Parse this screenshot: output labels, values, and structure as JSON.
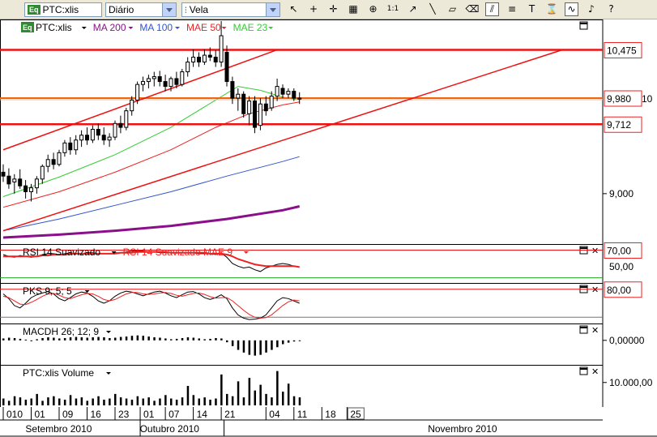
{
  "toolbar": {
    "symbol": "PTC:xlis",
    "symbol_badge": "Eq",
    "period": "Diário",
    "chart_type": "Vela",
    "tools": [
      {
        "name": "cursor-icon",
        "glyph": "↖"
      },
      {
        "name": "crosshair-icon",
        "glyph": "+"
      },
      {
        "name": "cross-arrow-icon",
        "glyph": "✛"
      },
      {
        "name": "grid-icon",
        "glyph": "▦"
      },
      {
        "name": "zoom-icon",
        "glyph": "⊕"
      },
      {
        "name": "zoom-1to1-icon",
        "glyph": "1:1"
      },
      {
        "name": "trend-arrow-icon",
        "glyph": "↗"
      },
      {
        "name": "trend-line-icon",
        "glyph": "╲"
      },
      {
        "name": "eraser-icon",
        "glyph": "▱"
      },
      {
        "name": "eraser-all-icon",
        "glyph": "⌫"
      },
      {
        "name": "channel-icon",
        "glyph": "⫽"
      },
      {
        "name": "fibonacci-icon",
        "glyph": "≡"
      },
      {
        "name": "text-tool-icon",
        "glyph": "T"
      },
      {
        "name": "alarm-icon",
        "glyph": "⌛"
      },
      {
        "name": "wave-icon",
        "glyph": "∿"
      },
      {
        "name": "bell-icon",
        "glyph": "♪"
      },
      {
        "name": "help-icon",
        "glyph": "?"
      }
    ]
  },
  "chart_data": [
    {
      "type": "candlestick",
      "panel": "price",
      "legend": [
        {
          "badge": "Eq",
          "label": "PTC:xlis",
          "color": "#000000"
        },
        {
          "label": "MA 200",
          "color": "#8b0f8b"
        },
        {
          "label": "MA 100",
          "color": "#3355cc"
        },
        {
          "label": "MAE 50",
          "color": "#ee2222"
        },
        {
          "label": "MAE 23",
          "color": "#33cc33"
        }
      ],
      "y_ticks": [
        "9,000"
      ],
      "y_tick_values": [
        9.0
      ],
      "ylim": [
        8.5,
        10.77
      ],
      "price_labels": [
        {
          "text": "10,475",
          "value": 10.475
        },
        {
          "text": "9,980",
          "value": 9.98
        },
        {
          "text": "9,712",
          "value": 9.712
        }
      ],
      "right_label_partial": "10",
      "horizontal_lines": [
        10.475,
        9.98,
        9.712
      ],
      "channel": [
        {
          "from": [
            0,
            9.45
          ],
          "to": [
            49,
            10.475
          ]
        },
        {
          "from": [
            0,
            8.62
          ],
          "to": [
            100,
            10.475
          ]
        }
      ],
      "candles": [
        {
          "o": 9.22,
          "h": 9.3,
          "l": 9.12,
          "c": 9.18
        },
        {
          "o": 9.18,
          "h": 9.26,
          "l": 9.05,
          "c": 9.1
        },
        {
          "o": 9.12,
          "h": 9.2,
          "l": 9.0,
          "c": 9.15
        },
        {
          "o": 9.15,
          "h": 9.25,
          "l": 9.05,
          "c": 9.08
        },
        {
          "o": 9.08,
          "h": 9.14,
          "l": 8.95,
          "c": 9.02
        },
        {
          "o": 9.02,
          "h": 9.1,
          "l": 8.92,
          "c": 9.06
        },
        {
          "o": 9.06,
          "h": 9.18,
          "l": 9.0,
          "c": 9.15
        },
        {
          "o": 9.15,
          "h": 9.3,
          "l": 9.1,
          "c": 9.28
        },
        {
          "o": 9.28,
          "h": 9.4,
          "l": 9.22,
          "c": 9.35
        },
        {
          "o": 9.35,
          "h": 9.42,
          "l": 9.25,
          "c": 9.3
        },
        {
          "o": 9.3,
          "h": 9.45,
          "l": 9.28,
          "c": 9.42
        },
        {
          "o": 9.42,
          "h": 9.55,
          "l": 9.38,
          "c": 9.52
        },
        {
          "o": 9.52,
          "h": 9.58,
          "l": 9.4,
          "c": 9.45
        },
        {
          "o": 9.45,
          "h": 9.6,
          "l": 9.4,
          "c": 9.55
        },
        {
          "o": 9.55,
          "h": 9.65,
          "l": 9.48,
          "c": 9.6
        },
        {
          "o": 9.6,
          "h": 9.68,
          "l": 9.5,
          "c": 9.55
        },
        {
          "o": 9.55,
          "h": 9.7,
          "l": 9.52,
          "c": 9.66
        },
        {
          "o": 9.66,
          "h": 9.72,
          "l": 9.55,
          "c": 9.6
        },
        {
          "o": 9.6,
          "h": 9.68,
          "l": 9.5,
          "c": 9.55
        },
        {
          "o": 9.55,
          "h": 9.62,
          "l": 9.48,
          "c": 9.58
        },
        {
          "o": 9.58,
          "h": 9.75,
          "l": 9.55,
          "c": 9.72
        },
        {
          "o": 9.72,
          "h": 9.8,
          "l": 9.62,
          "c": 9.68
        },
        {
          "o": 9.68,
          "h": 9.88,
          "l": 9.65,
          "c": 9.85
        },
        {
          "o": 9.85,
          "h": 10.0,
          "l": 9.8,
          "c": 9.96
        },
        {
          "o": 9.96,
          "h": 10.15,
          "l": 9.92,
          "c": 10.12
        },
        {
          "o": 10.12,
          "h": 10.2,
          "l": 10.05,
          "c": 10.15
        },
        {
          "o": 10.15,
          "h": 10.22,
          "l": 10.08,
          "c": 10.18
        },
        {
          "o": 10.18,
          "h": 10.25,
          "l": 10.1,
          "c": 10.2
        },
        {
          "o": 10.2,
          "h": 10.26,
          "l": 10.1,
          "c": 10.15
        },
        {
          "o": 10.15,
          "h": 10.22,
          "l": 10.05,
          "c": 10.1
        },
        {
          "o": 10.1,
          "h": 10.2,
          "l": 10.05,
          "c": 10.18
        },
        {
          "o": 10.18,
          "h": 10.25,
          "l": 10.08,
          "c": 10.12
        },
        {
          "o": 10.12,
          "h": 10.28,
          "l": 10.1,
          "c": 10.25
        },
        {
          "o": 10.25,
          "h": 10.4,
          "l": 10.2,
          "c": 10.35
        },
        {
          "o": 10.35,
          "h": 10.48,
          "l": 10.3,
          "c": 10.4
        },
        {
          "o": 10.4,
          "h": 10.45,
          "l": 10.3,
          "c": 10.35
        },
        {
          "o": 10.35,
          "h": 10.48,
          "l": 10.32,
          "c": 10.42
        },
        {
          "o": 10.42,
          "h": 10.5,
          "l": 10.36,
          "c": 10.4
        },
        {
          "o": 10.4,
          "h": 10.47,
          "l": 10.3,
          "c": 10.35
        },
        {
          "o": 10.35,
          "h": 10.77,
          "l": 10.3,
          "c": 10.62
        },
        {
          "o": 10.45,
          "h": 10.52,
          "l": 10.1,
          "c": 10.15
        },
        {
          "o": 10.15,
          "h": 10.2,
          "l": 9.92,
          "c": 9.98
        },
        {
          "o": 9.98,
          "h": 10.08,
          "l": 9.85,
          "c": 10.02
        },
        {
          "o": 10.02,
          "h": 10.05,
          "l": 9.78,
          "c": 9.82
        },
        {
          "o": 9.82,
          "h": 10.0,
          "l": 9.7,
          "c": 9.95
        },
        {
          "o": 9.95,
          "h": 10.0,
          "l": 9.62,
          "c": 9.68
        },
        {
          "o": 9.7,
          "h": 9.98,
          "l": 9.65,
          "c": 9.92
        },
        {
          "o": 9.92,
          "h": 10.0,
          "l": 9.8,
          "c": 9.85
        },
        {
          "o": 9.88,
          "h": 10.05,
          "l": 9.85,
          "c": 10.0
        },
        {
          "o": 10.0,
          "h": 10.18,
          "l": 9.95,
          "c": 10.1
        },
        {
          "o": 10.08,
          "h": 10.12,
          "l": 9.98,
          "c": 10.02
        },
        {
          "o": 10.02,
          "h": 10.08,
          "l": 9.98,
          "c": 10.05
        },
        {
          "o": 10.05,
          "h": 10.08,
          "l": 9.95,
          "c": 9.98
        },
        {
          "o": 9.98,
          "h": 10.04,
          "l": 9.92,
          "c": 9.97
        }
      ],
      "series": [
        {
          "name": "MAE 23",
          "color": "#33cc33",
          "points": [
            [
              0,
              8.97
            ],
            [
              10,
              9.17
            ],
            [
              20,
              9.4
            ],
            [
              30,
              9.68
            ],
            [
              38,
              9.96
            ],
            [
              42,
              10.1
            ],
            [
              46,
              10.06
            ],
            [
              50,
              9.99
            ],
            [
              53,
              9.96
            ]
          ]
        },
        {
          "name": "MAE 50",
          "color": "#ee2222",
          "points": [
            [
              0,
              8.86
            ],
            [
              10,
              9.02
            ],
            [
              20,
              9.22
            ],
            [
              30,
              9.45
            ],
            [
              38,
              9.68
            ],
            [
              44,
              9.82
            ],
            [
              50,
              9.91
            ],
            [
              53,
              9.94
            ]
          ]
        },
        {
          "name": "MA 100",
          "color": "#3355cc",
          "points": [
            [
              0,
              8.62
            ],
            [
              10,
              8.74
            ],
            [
              20,
              8.88
            ],
            [
              30,
              9.02
            ],
            [
              40,
              9.18
            ],
            [
              50,
              9.33
            ],
            [
              53,
              9.38
            ]
          ]
        },
        {
          "name": "MA 200",
          "color": "#8b0f8b",
          "points": [
            [
              0,
              8.55
            ],
            [
              10,
              8.58
            ],
            [
              20,
              8.62
            ],
            [
              30,
              8.67
            ],
            [
              40,
              8.74
            ],
            [
              50,
              8.83
            ],
            [
              53,
              8.87
            ]
          ]
        }
      ]
    },
    {
      "type": "line",
      "panel": "rsi",
      "legend": [
        {
          "label": "RSI 14 Suavizado",
          "color": "#000000"
        },
        {
          "label": "RSI 14 Suavizado MAE 9",
          "color": "#ee2222"
        }
      ],
      "y_ticks": [
        "50,00"
      ],
      "price_labels": [
        {
          "text": "70,00",
          "value": 70
        }
      ],
      "ylim": [
        35,
        75
      ],
      "horizontal_lines": [
        70,
        39
      ],
      "series": [
        {
          "name": "RSI 14 Suavizado",
          "color": "#000000",
          "values": [
            65,
            63,
            62,
            64,
            63,
            62,
            63,
            65,
            66,
            66,
            65,
            66,
            67,
            66,
            66,
            67,
            67,
            66,
            66,
            66,
            67,
            67,
            68,
            69,
            69,
            69,
            68,
            68,
            67,
            67,
            67,
            67,
            67,
            67,
            67,
            66,
            66,
            66,
            65,
            67,
            62,
            55,
            52,
            50,
            51,
            48,
            46,
            50,
            52,
            54,
            55,
            54,
            52,
            51
          ]
        },
        {
          "name": "RSI 14 Suavizado MAE 9",
          "color": "#ee2222",
          "values": [
            63,
            63,
            63,
            63,
            63,
            63,
            63,
            64,
            64,
            65,
            65,
            65,
            66,
            66,
            66,
            66,
            66,
            66,
            66,
            66,
            66,
            67,
            67,
            67,
            68,
            68,
            68,
            68,
            68,
            68,
            67,
            67,
            67,
            67,
            67,
            67,
            67,
            66,
            66,
            66,
            65,
            63,
            60,
            58,
            56,
            54,
            53,
            52,
            52,
            52,
            52,
            52,
            52,
            51
          ]
        }
      ]
    },
    {
      "type": "line",
      "panel": "stochastic",
      "legend": [
        {
          "label": "PKS 9; 5; 5",
          "color": "#000000"
        }
      ],
      "price_labels": [
        {
          "text": "80,00",
          "value": 80
        }
      ],
      "ylim": [
        10,
        90
      ],
      "horizontal_lines": [
        80,
        20
      ],
      "series": [
        {
          "name": "PKS %K",
          "color": "#000000",
          "values": [
            70,
            60,
            45,
            40,
            50,
            62,
            68,
            72,
            75,
            70,
            60,
            55,
            62,
            70,
            74,
            72,
            65,
            55,
            50,
            55,
            65,
            72,
            76,
            74,
            70,
            66,
            70,
            74,
            76,
            72,
            66,
            62,
            68,
            74,
            75,
            70,
            62,
            58,
            62,
            68,
            60,
            40,
            25,
            18,
            15,
            16,
            18,
            25,
            40,
            55,
            62,
            60,
            55,
            50
          ]
        },
        {
          "name": "PKS %D",
          "color": "#ee2222",
          "values": [
            65,
            62,
            55,
            48,
            47,
            52,
            58,
            65,
            70,
            71,
            67,
            62,
            60,
            64,
            68,
            71,
            70,
            65,
            58,
            55,
            58,
            64,
            70,
            73,
            73,
            70,
            69,
            70,
            72,
            73,
            71,
            67,
            65,
            68,
            71,
            72,
            69,
            64,
            61,
            62,
            62,
            55,
            45,
            35,
            26,
            20,
            18,
            19,
            25,
            35,
            45,
            53,
            57,
            55
          ]
        }
      ]
    },
    {
      "type": "histogram",
      "panel": "macd",
      "legend": [
        {
          "label": "MACDH 26; 12; 9",
          "color": "#000000"
        }
      ],
      "y_ticks": [
        "0,00000"
      ],
      "ylim": [
        -0.6,
        0.4
      ],
      "values": [
        0.05,
        0.07,
        0.06,
        0.04,
        0.02,
        0.0,
        0.03,
        0.06,
        0.08,
        0.07,
        0.05,
        0.06,
        0.08,
        0.09,
        0.08,
        0.07,
        0.08,
        0.09,
        0.08,
        0.06,
        0.07,
        0.09,
        0.1,
        0.12,
        0.13,
        0.12,
        0.1,
        0.08,
        0.07,
        0.05,
        0.03,
        0.04,
        0.06,
        0.08,
        0.07,
        0.05,
        0.03,
        0.04,
        0.06,
        0.05,
        -0.05,
        -0.15,
        -0.25,
        -0.32,
        -0.38,
        -0.4,
        -0.38,
        -0.32,
        -0.25,
        -0.18,
        -0.1,
        -0.06,
        -0.03,
        -0.02
      ]
    },
    {
      "type": "bar",
      "panel": "volume",
      "legend": [
        {
          "label": "PTC:xlis Volume",
          "color": "#000000"
        }
      ],
      "y_ticks": [
        "10.000,00"
      ],
      "y_tick_values": [
        10000
      ],
      "ylim": [
        0,
        17000
      ],
      "values": [
        3000,
        2000,
        4000,
        3500,
        2500,
        3000,
        5000,
        2000,
        3500,
        4000,
        3000,
        2500,
        4500,
        3000,
        3500,
        2000,
        3000,
        4000,
        2500,
        3000,
        5000,
        3500,
        3000,
        2500,
        4000,
        3000,
        3500,
        2000,
        3000,
        4500,
        3000,
        2500,
        3500,
        8500,
        4500,
        3000,
        3500,
        2500,
        3000,
        13500,
        5000,
        4000,
        10500,
        3500,
        12000,
        6500,
        9000,
        5000,
        3500,
        15000,
        6000,
        9500,
        4000,
        3500
      ],
      "x_day_labels": [
        "010",
        "01",
        "09",
        "16",
        "23",
        "01",
        "07",
        "14",
        "21",
        "04",
        "11",
        "18",
        "25"
      ],
      "x_day_positions": [
        0,
        5,
        10,
        15,
        20,
        24.5,
        29,
        34,
        39,
        47,
        52,
        57,
        61.5
      ],
      "x_month_labels": [
        "Setembro 2010",
        "Outubro 2010",
        "Novembro 2010"
      ],
      "x_month_positions": [
        10,
        30,
        82
      ]
    }
  ]
}
